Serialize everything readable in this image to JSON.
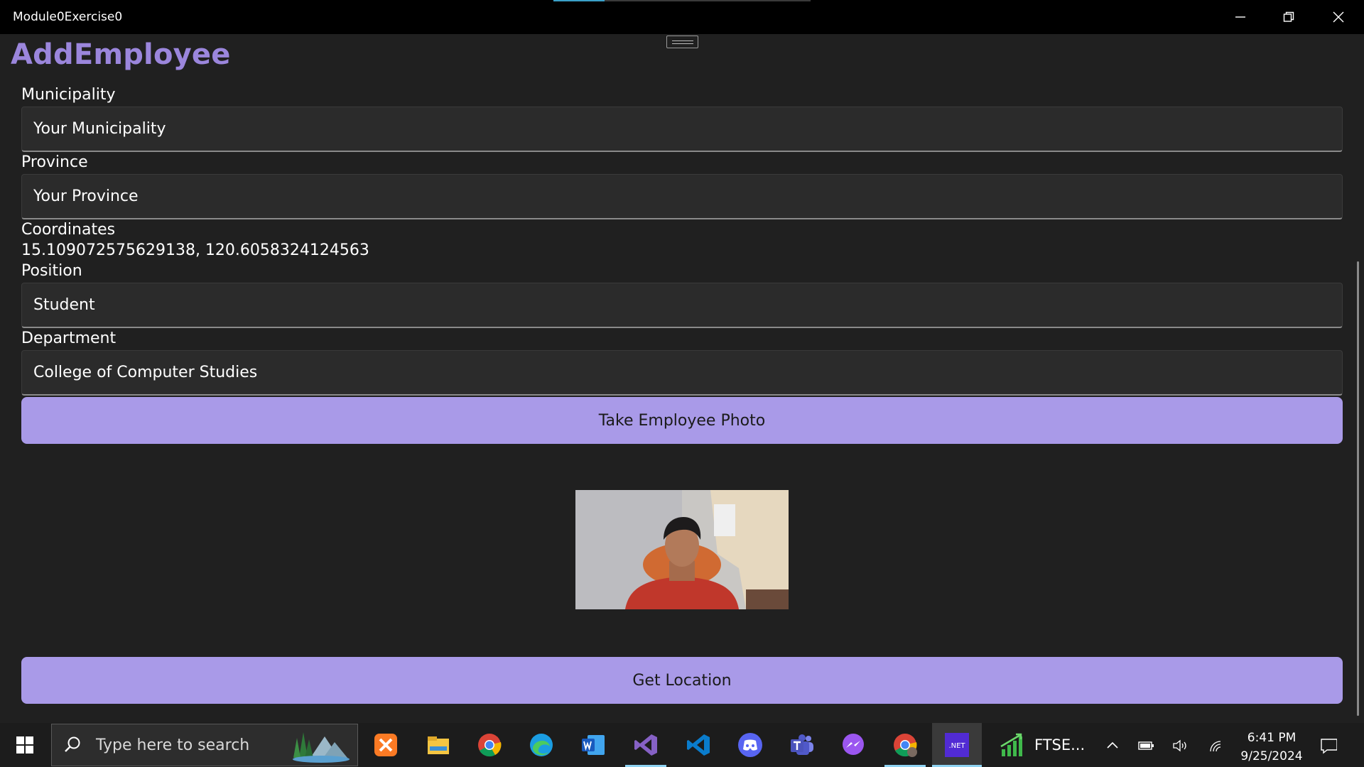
{
  "window": {
    "title": "Module0Exercise0"
  },
  "page": {
    "title": "AddEmployee"
  },
  "form": {
    "municipality": {
      "label": "Municipality",
      "value": "Your Municipality"
    },
    "province": {
      "label": "Province",
      "value": "Your Province"
    },
    "coordinates": {
      "label": "Coordinates",
      "value": "15.109072575629138, 120.6058324124563"
    },
    "position": {
      "label": "Position",
      "value": "Student"
    },
    "department": {
      "label": "Department",
      "value": "College of Computer Studies"
    }
  },
  "buttons": {
    "take_photo": "Take Employee Photo",
    "get_location": "Get Location"
  },
  "taskbar": {
    "search_placeholder": "Type here to search",
    "apps": [
      "xampp-icon",
      "file-explorer-icon",
      "chrome-icon",
      "edge-icon",
      "word-icon",
      "visual-studio-icon",
      "vscode-icon",
      "discord-icon",
      "teams-icon",
      "messenger-icon",
      "chrome-profile-icon",
      "dotnet-icon",
      "stock-chart-icon"
    ],
    "ftse_label": "FTSE...",
    "time": "6:41 PM",
    "date": "9/25/2024"
  },
  "colors": {
    "accent": "#9b86dc",
    "button": "#a99ae8",
    "background": "#202020"
  }
}
